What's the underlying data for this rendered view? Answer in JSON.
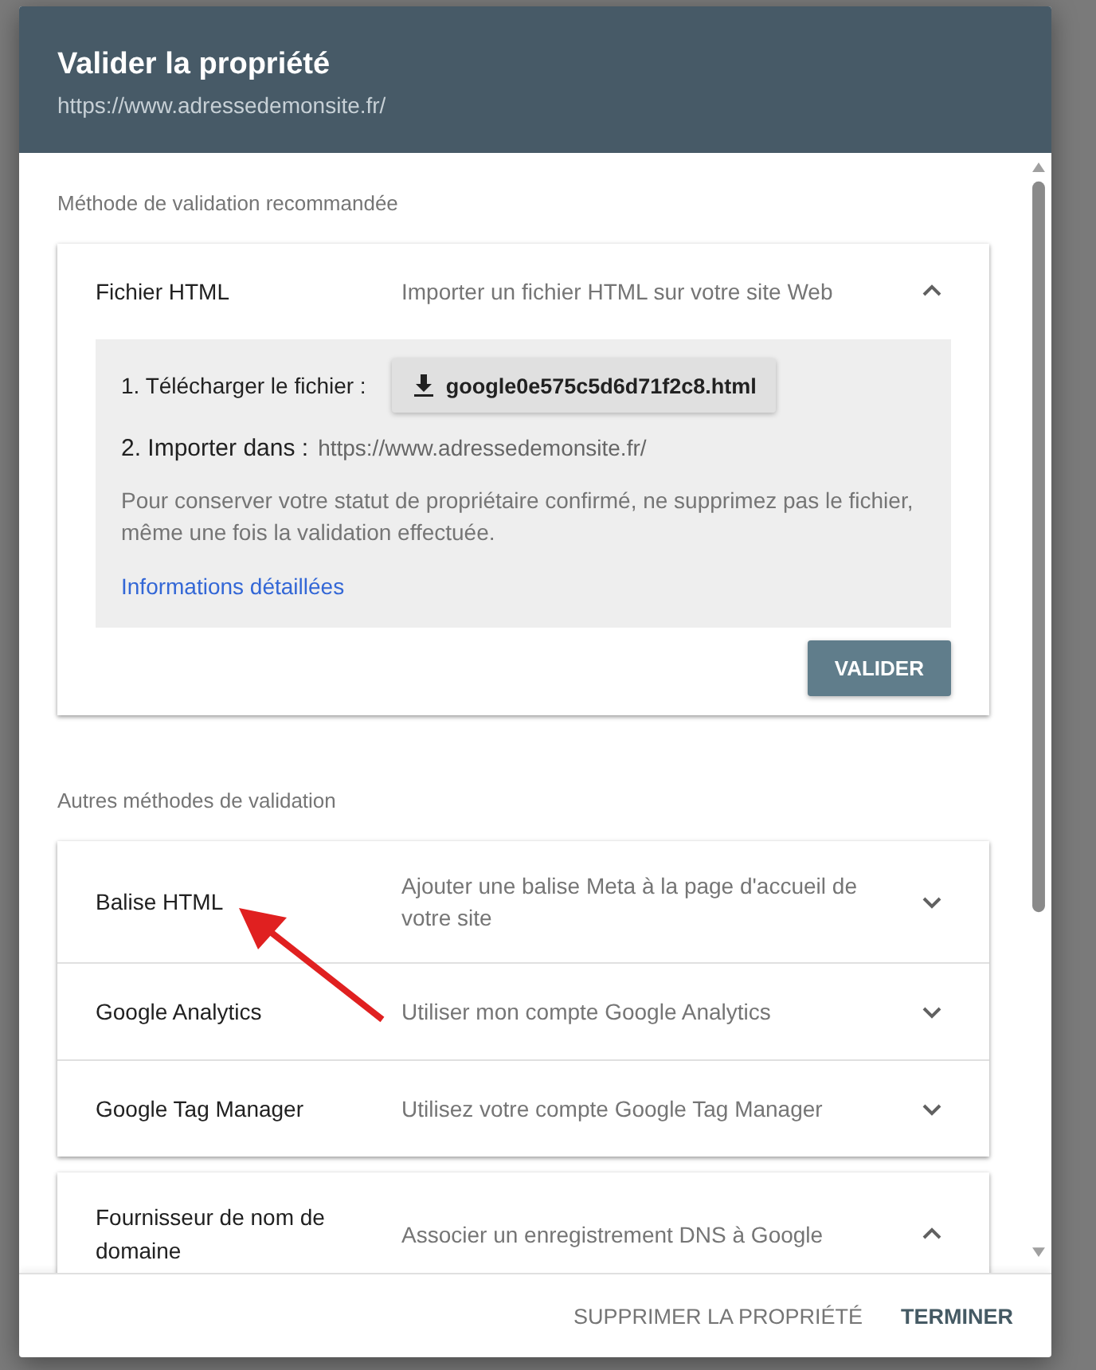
{
  "dialog": {
    "title": "Valider la propriété",
    "subtitle": "https://www.adressedemonsite.fr/"
  },
  "recommended": {
    "heading": "Méthode de validation recommandée",
    "methods": [
      {
        "title": "Fichier HTML",
        "description": "Importer un fichier HTML sur votre site Web",
        "expanded": true,
        "details": {
          "step1_label": "1. Télécharger le fichier :",
          "download_file": "google0e575c5d6d71f2c8.html",
          "step2_label": "2. Importer dans :",
          "step2_url": "https://www.adressedemonsite.fr/",
          "note": "Pour conserver votre statut de propriétaire confirmé, ne supprimez pas le fichier, même une fois la validation effectuée.",
          "link": "Informations détaillées",
          "button": "VALIDER"
        }
      }
    ]
  },
  "other": {
    "heading": "Autres méthodes de validation",
    "groups": [
      [
        {
          "title": "Balise HTML",
          "description": "Ajouter une balise Meta à la page d'accueil de votre site",
          "expanded": false
        },
        {
          "title": "Google Analytics",
          "description": "Utiliser mon compte Google Analytics",
          "expanded": false
        },
        {
          "title": "Google Tag Manager",
          "description": "Utilisez votre compte Google Tag Manager",
          "expanded": false
        }
      ],
      [
        {
          "title": "Fournisseur de nom de domaine",
          "description": "Associer un enregistrement DNS à Google",
          "expanded": true
        }
      ]
    ]
  },
  "footer": {
    "buttons": [
      "SUPPRIMER LA PROPRIÉTÉ",
      "TERMINER"
    ]
  }
}
